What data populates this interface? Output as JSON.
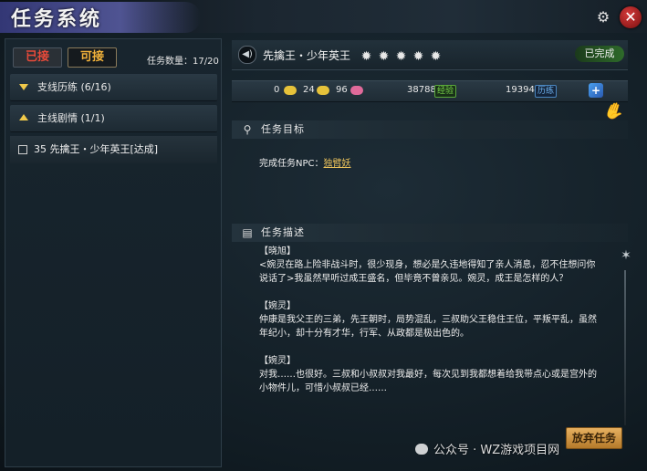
{
  "window": {
    "title": "任务系统"
  },
  "icons": {
    "settings": "gear-icon",
    "close": "close-icon",
    "speaker": "speaker-icon",
    "goal": "pin-icon",
    "desc": "scroll-icon",
    "reward_add": "plus-icon",
    "claw": "claw-icon",
    "bell": "bell-icon"
  },
  "left_panel": {
    "tabs": [
      {
        "label": "已接",
        "active": false
      },
      {
        "label": "可接",
        "active": true
      }
    ],
    "quest_count": "任务数量：17/20",
    "categories": [
      {
        "label": "支线历练 (6/16)",
        "expanded": true
      },
      {
        "label": "主线剧情 (1/1)",
        "expanded": false
      }
    ],
    "quests": [
      {
        "label": "35 先擒王・少年英王[达成]"
      }
    ]
  },
  "quest_detail": {
    "name": "先擒王・少年英王",
    "stars": 5,
    "status": "已完成",
    "rewards": {
      "gold": "0",
      "silver": "24",
      "gem": "96",
      "exp_value": "38788",
      "exp_tag": "经验",
      "skill_value": "19394",
      "skill_tag": "历练"
    },
    "goal_header": "任务目标",
    "goal_text": "完成任务NPC：",
    "goal_npc": "独臂妖",
    "desc_header": "任务描述",
    "description": [
      {
        "speaker": "【晓旭】",
        "lines": [
          "<婉灵在路上险非战斗时，很少现身，想必是久违地得知了亲人消息，忍不住想问你",
          "说话了>我虽然早听过成王盛名，但毕竟不曾亲见。婉灵，成王是怎样的人？"
        ]
      },
      {
        "speaker": "【婉灵】",
        "lines": [
          "仲康是我父王的三弟，先王朝时，局势混乱，三叔助父王稳住王位，平叛平乱，虽然",
          "年纪小，却十分有才华，行军、从政都是极出色的。"
        ]
      },
      {
        "speaker": "【婉灵】",
        "lines": [
          "对我……也很好。三叔和小叔叔对我最好，每次见到我都想着给我带点心或是宫外的",
          "小物件儿，可惜小叔叔已经……"
        ]
      }
    ],
    "abandon_label": "放弃任务"
  },
  "watermark": "公众号 · WZ游戏项目网"
}
